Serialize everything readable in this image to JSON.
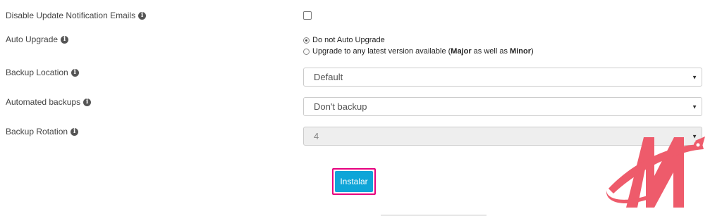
{
  "fields": {
    "disable_emails": {
      "label": "Disable Update Notification Emails",
      "checked": false
    },
    "auto_upgrade": {
      "label": "Auto Upgrade",
      "options": {
        "do_not": "Do not Auto Upgrade",
        "upgrade_prefix": "Upgrade to any latest version available (",
        "major": "Major",
        "middle": " as well as ",
        "minor": "Minor",
        "suffix": ")"
      },
      "selected": "Do not Auto Upgrade"
    },
    "backup_location": {
      "label": "Backup Location",
      "value": "Default"
    },
    "automated_backups": {
      "label": "Automated backups",
      "value": "Don't backup"
    },
    "backup_rotation": {
      "label": "Backup Rotation",
      "value": "4",
      "disabled": true
    }
  },
  "actions": {
    "install_label": "Instalar"
  },
  "icons": {
    "info": "info-icon",
    "caret": "caret-down-icon",
    "logo": "brand-logo"
  },
  "colors": {
    "install_button": "#0ea5d8",
    "install_highlight": "#e6007e",
    "logo": "#ee5b6b"
  }
}
